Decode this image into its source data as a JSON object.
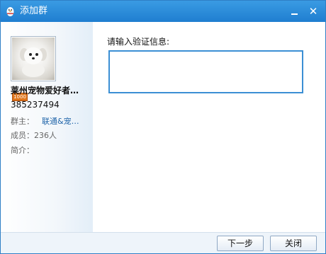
{
  "window": {
    "title": "添加群",
    "accent_color": "#1f7ed0",
    "icons": {
      "app": "qq-penguin-icon",
      "minimize": "minimize-icon",
      "close": "close-icon"
    },
    "close_glyph": "✕"
  },
  "group": {
    "name": "莱州宠物爱好者…",
    "id": "385237494",
    "level_badge": "1000",
    "owner_label": "群主：",
    "owner_name": "联通&宠…",
    "members_label": "成员：236人",
    "intro_label": "简介："
  },
  "form": {
    "prompt": "请输入验证信息:",
    "value": ""
  },
  "buttons": {
    "next": "下一步",
    "cancel": "关闭"
  }
}
